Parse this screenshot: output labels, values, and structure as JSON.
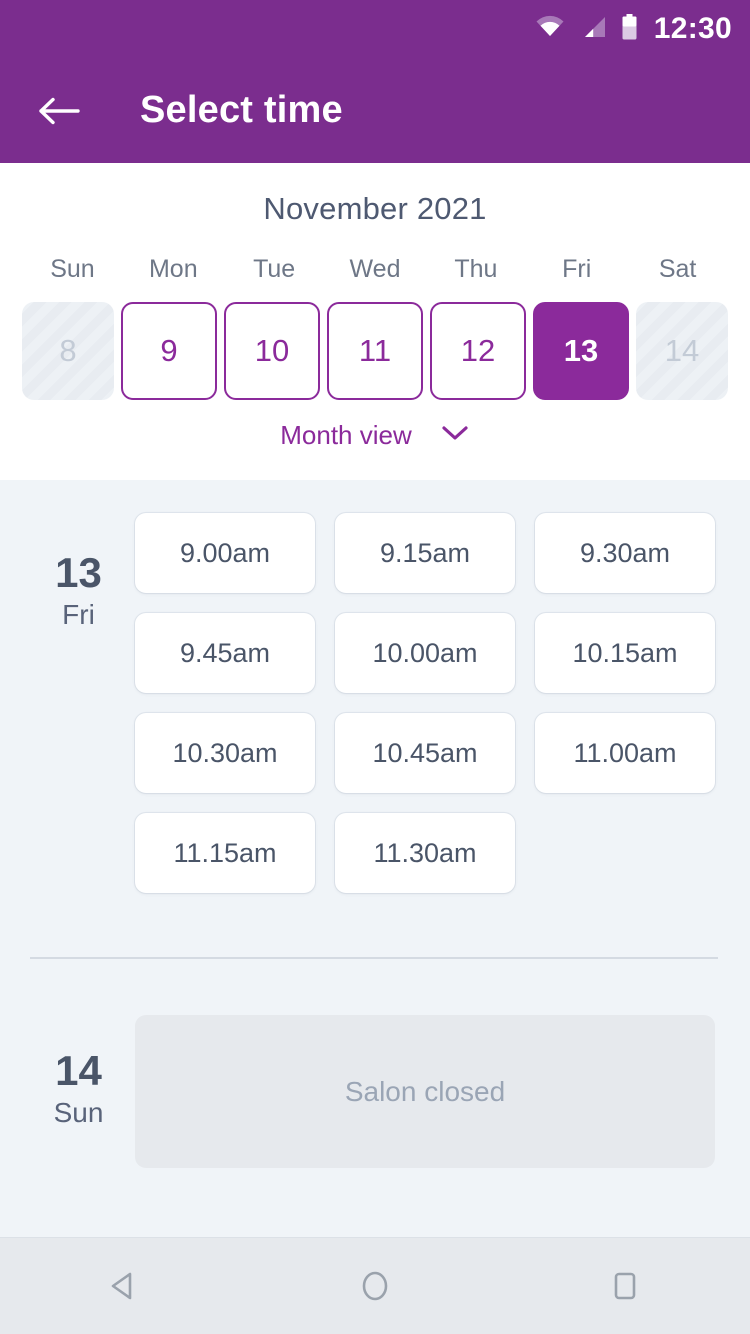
{
  "status_bar": {
    "time": "12:30",
    "icons": [
      "wifi-icon",
      "cellular-signal-icon",
      "battery-icon"
    ]
  },
  "app_bar": {
    "back_icon": "arrow-left-icon",
    "title": "Select time"
  },
  "calendar": {
    "month_title": "November 2021",
    "weekdays": [
      "Sun",
      "Mon",
      "Tue",
      "Wed",
      "Thu",
      "Fri",
      "Sat"
    ],
    "days": [
      {
        "num": "8",
        "state": "disabled"
      },
      {
        "num": "9",
        "state": "available"
      },
      {
        "num": "10",
        "state": "available"
      },
      {
        "num": "11",
        "state": "available"
      },
      {
        "num": "12",
        "state": "available"
      },
      {
        "num": "13",
        "state": "selected"
      },
      {
        "num": "14",
        "state": "disabled"
      }
    ],
    "month_view_label": "Month view",
    "month_view_icon": "chevron-down-icon"
  },
  "slots": {
    "groups": [
      {
        "date_num": "13",
        "date_dow": "Fri",
        "times": [
          "9.00am",
          "9.15am",
          "9.30am",
          "9.45am",
          "10.00am",
          "10.15am",
          "10.30am",
          "10.45am",
          "11.00am",
          "11.15am",
          "11.30am"
        ]
      },
      {
        "date_num": "14",
        "date_dow": "Sun",
        "closed_label": "Salon closed"
      }
    ]
  },
  "nav_bar": {
    "back_icon": "triangle-back-icon",
    "home_icon": "circle-home-icon",
    "recents_icon": "square-recents-icon"
  },
  "colors": {
    "brand_purple": "#7B2D8E",
    "accent_purple": "#8B2A9B",
    "page_bg": "#F0F4F8",
    "text_dark": "#4A5568",
    "text_muted": "#9AA5B5"
  }
}
